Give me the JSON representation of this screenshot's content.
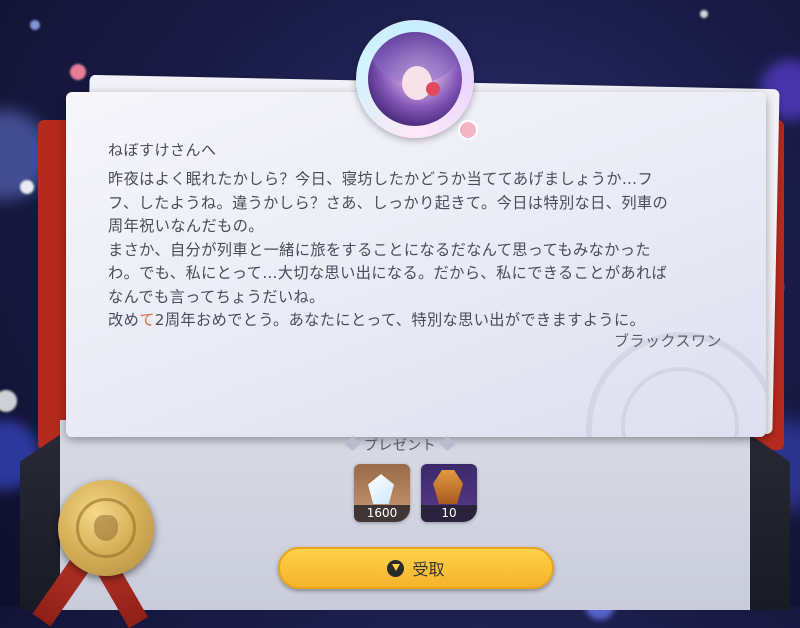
{
  "letter": {
    "salutation": "ねぼすけさんへ",
    "body_lines": [
      "昨夜はよく眠れたかしら？今日、寝坊したかどうか当ててあげましょうか…フ",
      "フ、したようね。違うかしら？さあ、しっかり起きて。今日は特別な日、列車の",
      "周年祝いなんだもの。",
      "まさか、自分が列車と一緒に旅をすることになるだなんて思ってもみなかった",
      "わ。でも、私にとって…大切な思い出になる。だから、私にできることがあれば",
      "なんでも言ってちょうだいね。"
    ],
    "last_line_prefix": "改め",
    "last_line_accent": "て",
    "last_line_suffix": "2周年おめでとう。あなたにとって、特別な思い出ができますように。",
    "signature": "ブラックスワン"
  },
  "present": {
    "label": "プレゼント",
    "items": [
      {
        "name": "crystal-item",
        "count": "1600"
      },
      {
        "name": "lantern-item",
        "count": "10"
      }
    ]
  },
  "receive_button": {
    "label": "受取",
    "icon": "download-icon"
  },
  "colors": {
    "button": "#f3b42a",
    "accent_text": "#e06a42",
    "seal": "#d8b25a",
    "ribbon": "#b52a1e"
  }
}
